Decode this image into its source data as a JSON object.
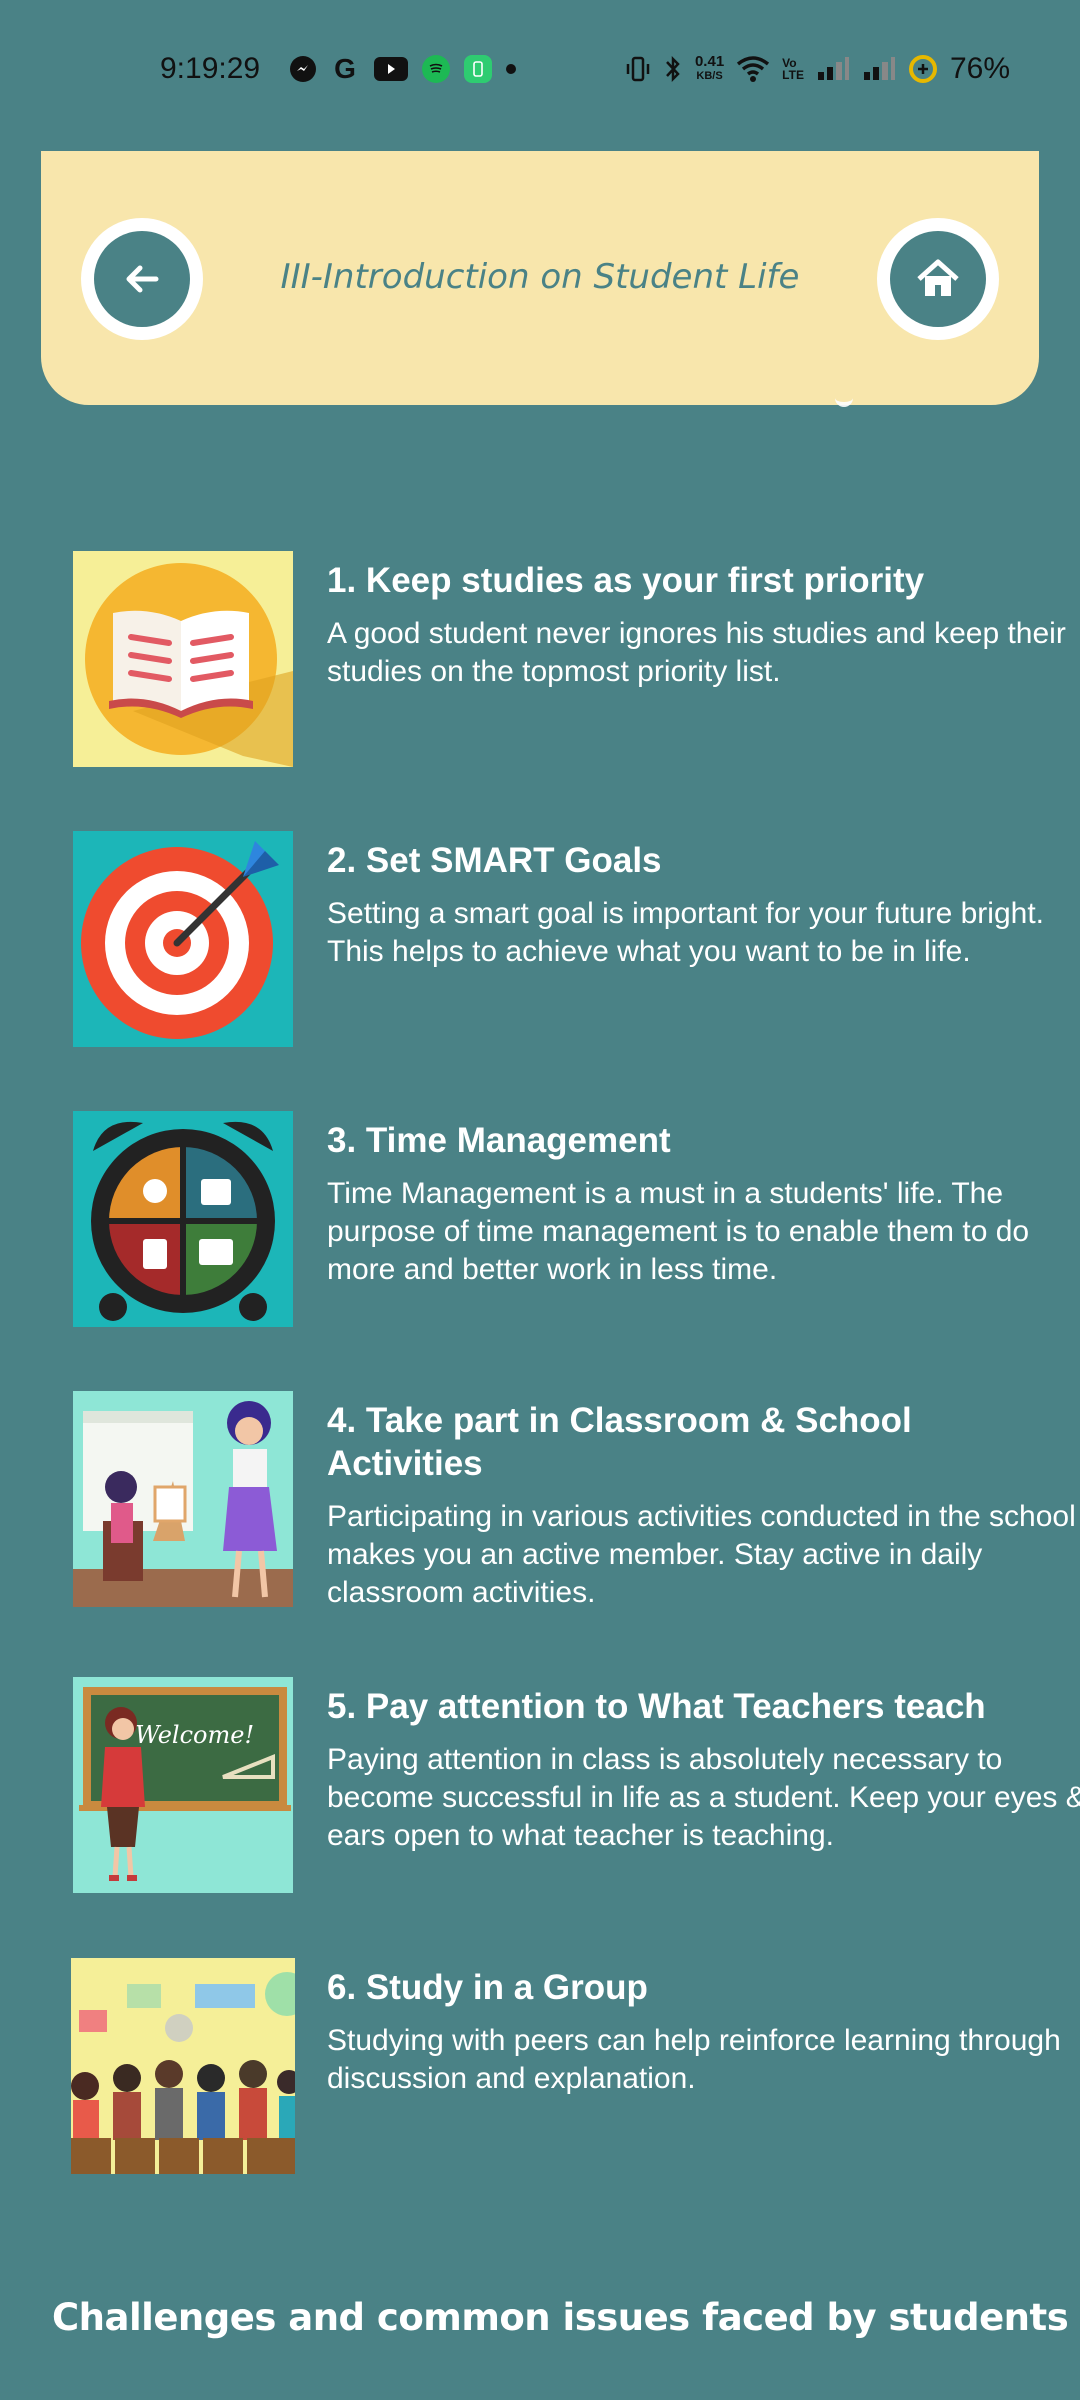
{
  "status_bar": {
    "time": "9:19:29",
    "net_speed": "0.41",
    "net_unit": "KB/S",
    "battery": "76%"
  },
  "header": {
    "title": "III-Introduction on Student Life",
    "back_icon": "arrow-left-icon",
    "home_icon": "home-icon"
  },
  "items": [
    {
      "title": "1. Keep studies as your first priority",
      "desc": "A good student never ignores his studies and keep their studies on the topmost priority list.",
      "image": "open-book-illustration"
    },
    {
      "title": "2. Set SMART Goals",
      "desc": "Setting a smart goal is important for your future bright. This helps to achieve what you want to be in life.",
      "image": "target-dart-illustration"
    },
    {
      "title": "3. Time Management",
      "desc": "Time Management is a must in a students' life. The purpose of time management is to enable them to do more and better work in less time.",
      "image": "alarm-clock-illustration"
    },
    {
      "title": "4. Take part in Classroom & School Activities",
      "desc": "Participating in various activities conducted in the school makes you an active member. Stay active in daily classroom activities.",
      "image": "classroom-painting-illustration"
    },
    {
      "title": "5. Pay attention to What Teachers teach",
      "desc": "Paying attention in class is absolutely necessary to become successful in life as a student. Keep your eyes & ears open to what teacher is teaching.",
      "image": "teacher-blackboard-illustration"
    },
    {
      "title": "6. Study in a Group",
      "desc": "Studying with peers can help reinforce learning through discussion and explanation.",
      "image": "study-group-illustration"
    }
  ],
  "blackboard_text": "Welcome!",
  "section_heading": "Challenges and common issues faced by students",
  "colors": {
    "background": "#4a8286",
    "header": "#f8e6ac",
    "accent": "#4a8286"
  }
}
